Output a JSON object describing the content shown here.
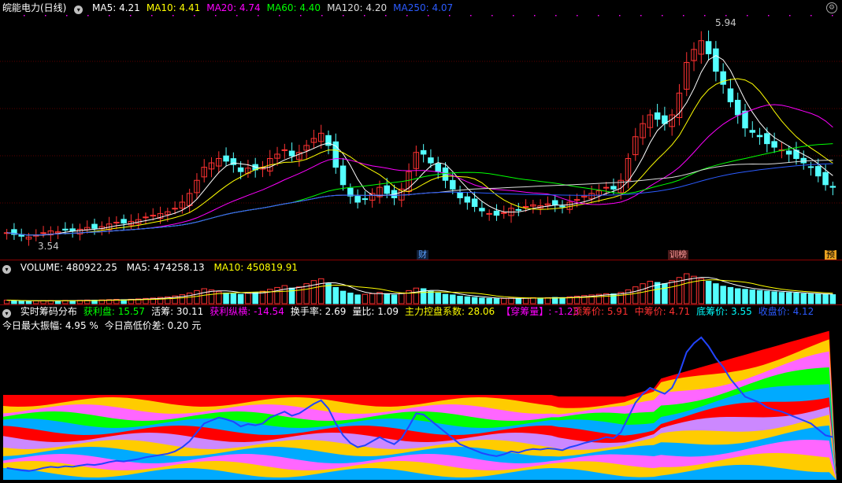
{
  "header": {
    "title": "皖能电力(日线)",
    "ma": [
      {
        "label": "MA5: 4.21",
        "color": "#ffffff"
      },
      {
        "label": "MA10: 4.41",
        "color": "#ffff00"
      },
      {
        "label": "MA20: 4.74",
        "color": "#ff00ff"
      },
      {
        "label": "MA60: 4.40",
        "color": "#00ff00"
      },
      {
        "label": "MA120: 4.20",
        "color": "#dddddd"
      },
      {
        "label": "MA250: 4.07",
        "color": "#2b5bff"
      }
    ]
  },
  "price_chart": {
    "high_label": "5.94",
    "low_label": "3.54",
    "markers": [
      {
        "text": "财",
        "color": "#5aa0ff",
        "bg": "#10203a"
      },
      {
        "text": "训榜",
        "color": "#ff9a9a",
        "bg": "#4a1a1a"
      },
      {
        "text": "预",
        "color": "#000000",
        "bg": "#e8a020"
      }
    ]
  },
  "volume": {
    "label": "VOLUME: 480922.25",
    "ma5": "MA5: 474258.13",
    "ma10": "MA10: 450819.91",
    "colors": {
      "label": "#ffffff",
      "ma5": "#ffffff",
      "ma10": "#ffff00"
    }
  },
  "chips": {
    "row1": [
      {
        "text": "实时筹码分布",
        "color": "#ffffff"
      },
      {
        "text": "获利盘: 15.57",
        "color": "#00ff00"
      },
      {
        "text": "活筹: 30.11",
        "color": "#ffffff"
      },
      {
        "text": "获利纵横: -14.54",
        "color": "#ff00ff"
      },
      {
        "text": "换手率: 2.69",
        "color": "#ffffff"
      },
      {
        "text": "量比: 1.09",
        "color": "#ffffff"
      },
      {
        "text": "主力控盘系数: 28.06",
        "color": "#ffff00"
      },
      {
        "text": "【穿筹量】: -1.23",
        "color": "#ff00ff"
      }
    ],
    "right": [
      {
        "text": "顶筹价: 5.91",
        "color": "#ff3030"
      },
      {
        "text": "中筹价: 4.71",
        "color": "#ff3030"
      },
      {
        "text": "底筹价: 3.55",
        "color": "#00ffff"
      },
      {
        "text": "收盘价: 4.12",
        "color": "#2b5bff"
      }
    ],
    "row2": [
      {
        "text": "今日最大振幅: 4.95 %",
        "color": "#ffffff"
      },
      {
        "text": "今日高低价差: 0.20 元",
        "color": "#ffffff"
      }
    ]
  },
  "chart_data": {
    "type": "candlestick",
    "y_range": [
      3.4,
      6.05
    ],
    "high": 5.94,
    "low": 3.54,
    "closes": [
      3.6,
      3.58,
      3.56,
      3.55,
      3.57,
      3.6,
      3.62,
      3.61,
      3.63,
      3.62,
      3.64,
      3.66,
      3.65,
      3.67,
      3.7,
      3.72,
      3.71,
      3.73,
      3.75,
      3.78,
      3.8,
      3.82,
      3.84,
      3.88,
      3.95,
      4.05,
      4.2,
      4.35,
      4.4,
      4.45,
      4.42,
      4.38,
      4.3,
      4.34,
      4.32,
      4.35,
      4.45,
      4.5,
      4.55,
      4.48,
      4.52,
      4.6,
      4.68,
      4.74,
      4.6,
      4.35,
      4.15,
      4.02,
      3.95,
      3.98,
      4.05,
      4.12,
      4.05,
      4.0,
      4.1,
      4.3,
      4.52,
      4.5,
      4.4,
      4.3,
      4.2,
      4.1,
      4.0,
      3.95,
      3.9,
      3.85,
      3.82,
      3.8,
      3.83,
      3.88,
      3.86,
      3.9,
      3.92,
      3.91,
      3.93,
      3.92,
      3.9,
      3.95,
      3.98,
      4.02,
      4.05,
      4.08,
      4.12,
      4.1,
      4.2,
      4.45,
      4.7,
      4.85,
      4.95,
      4.9,
      4.85,
      4.95,
      5.2,
      5.55,
      5.7,
      5.8,
      5.65,
      5.45,
      5.3,
      5.1,
      4.95,
      4.8,
      4.75,
      4.7,
      4.62,
      4.58,
      4.55,
      4.5,
      4.45,
      4.4,
      4.35,
      4.25,
      4.15,
      4.12
    ],
    "volume": [
      0.28,
      0.25,
      0.22,
      0.2,
      0.22,
      0.24,
      0.25,
      0.23,
      0.26,
      0.24,
      0.27,
      0.29,
      0.27,
      0.3,
      0.32,
      0.34,
      0.32,
      0.35,
      0.38,
      0.42,
      0.45,
      0.5,
      0.55,
      0.62,
      0.72,
      0.85,
      1.05,
      1.2,
      1.1,
      0.95,
      0.85,
      0.8,
      0.75,
      0.85,
      0.9,
      1.0,
      1.15,
      1.3,
      1.45,
      1.25,
      1.35,
      1.6,
      1.85,
      2.0,
      1.6,
      1.3,
      1.0,
      0.85,
      0.7,
      0.75,
      0.8,
      0.9,
      0.8,
      0.7,
      0.85,
      1.05,
      1.25,
      1.2,
      1.0,
      0.85,
      0.75,
      0.7,
      0.6,
      0.55,
      0.5,
      0.45,
      0.42,
      0.4,
      0.42,
      0.45,
      0.42,
      0.45,
      0.48,
      0.45,
      0.48,
      0.5,
      0.48,
      0.55,
      0.6,
      0.65,
      0.7,
      0.75,
      0.8,
      0.78,
      0.9,
      1.1,
      1.35,
      1.6,
      1.8,
      1.7,
      1.6,
      1.85,
      2.1,
      2.4,
      2.2,
      2.0,
      1.8,
      1.6,
      1.4,
      1.3,
      1.2,
      1.15,
      1.1,
      1.05,
      1.0,
      0.95,
      0.9,
      0.88,
      0.85,
      0.8,
      0.78,
      0.76,
      0.74,
      0.72
    ]
  }
}
